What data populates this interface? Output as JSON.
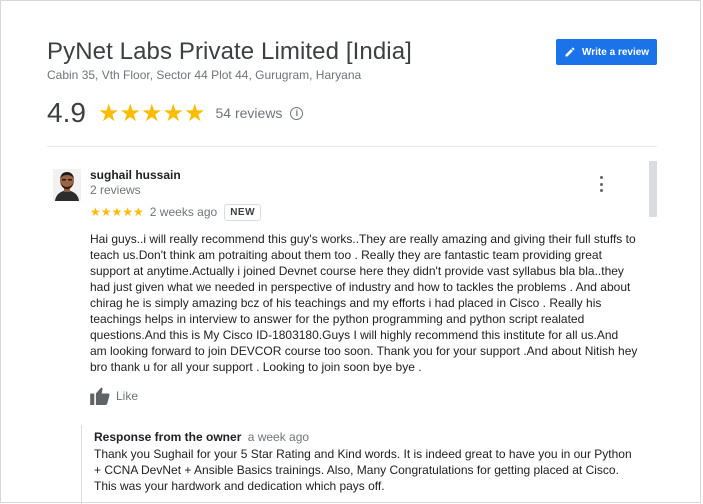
{
  "business": {
    "name": "PyNet Labs Private Limited [India]",
    "address": "Cabin 35, Vth Floor, Sector 44 Plot 44, Gurugram, Haryana",
    "rating": "4.9",
    "stars": "★★★★★",
    "review_count": "54 reviews",
    "info_glyph": "i"
  },
  "write_review": {
    "label": "Write a review"
  },
  "review": {
    "author": "sughail hussain",
    "author_meta": "2 reviews",
    "stars": "★★★★★",
    "date": "2 weeks ago",
    "badge": "NEW",
    "text": "Hai guys..i will really recommend this guy's works..They are really amazing and giving their full stuffs to teach us.Don't think am potraiting about them too . Really they are fantastic team providing great support at anytime.Actually i joined Devnet course here they didn't provide vast syllabus bla bla..they had just given what we needed in perspective of industry and how to tackles the problems . And about chirag he is simply amazing bcz of his teachings and my efforts i had placed in Cisco . Really his teachings helps in interview to answer for the python programming and python script realated questions.And this is My Cisco ID-1803180.Guys I will highly recommend this institute for all us.And am looking forward to join DEVCOR course too soon. Thank you for your support .And about Nitish hey bro thank u for all your support . Looking to join soon bye bye .",
    "like_label": "Like"
  },
  "owner_response": {
    "title": "Response from the owner",
    "date": "a week ago",
    "text": "Thank you Sughail for your 5 Star Rating and Kind words. It is indeed great to have you in our Python + CCNA DevNet + Ansible Basics trainings. Also, Many Congratulations for getting placed at Cisco. This was your hardwork and dedication which pays off."
  },
  "colors": {
    "accent": "#1a73e8",
    "star": "#fbbc04",
    "secondary_text": "#70757a"
  }
}
